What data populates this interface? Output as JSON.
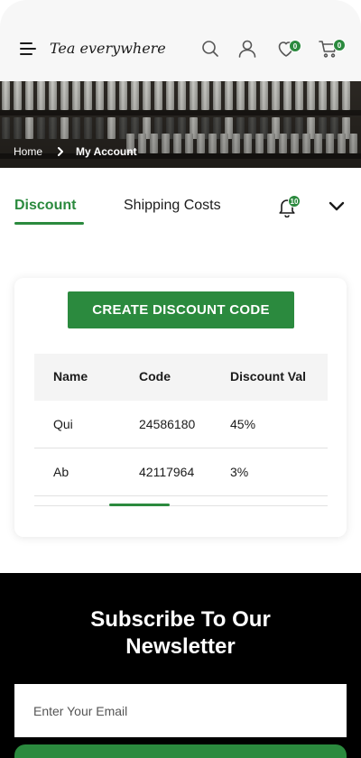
{
  "header": {
    "logo": "Tea everywhere",
    "wishlist_count": "0",
    "cart_count": "0",
    "icons": [
      "menu-icon",
      "search-icon",
      "user-icon",
      "heart-icon",
      "cart-icon"
    ]
  },
  "breadcrumb": {
    "home": "Home",
    "current": "My Account"
  },
  "tabs": {
    "discount": "Discount",
    "shipping": "Shipping Costs",
    "notification_count": "10"
  },
  "discount_card": {
    "create_button": "CREATE DISCOUNT CODE",
    "columns": [
      "Name",
      "Code",
      "Discount Val"
    ],
    "rows": [
      {
        "name": "Qui",
        "code": "24586180",
        "value": "45%"
      },
      {
        "name": "Ab",
        "code": "42117964",
        "value": "3%"
      }
    ]
  },
  "newsletter": {
    "title_line1": "Subscribe To Our",
    "title_line2": "Newsletter",
    "email_placeholder": "Enter Your Email"
  },
  "colors": {
    "accent": "#2b8a3e",
    "text": "#1b1b1b",
    "header_bg": "#f7f7f7",
    "newsletter_bg": "#000000"
  }
}
